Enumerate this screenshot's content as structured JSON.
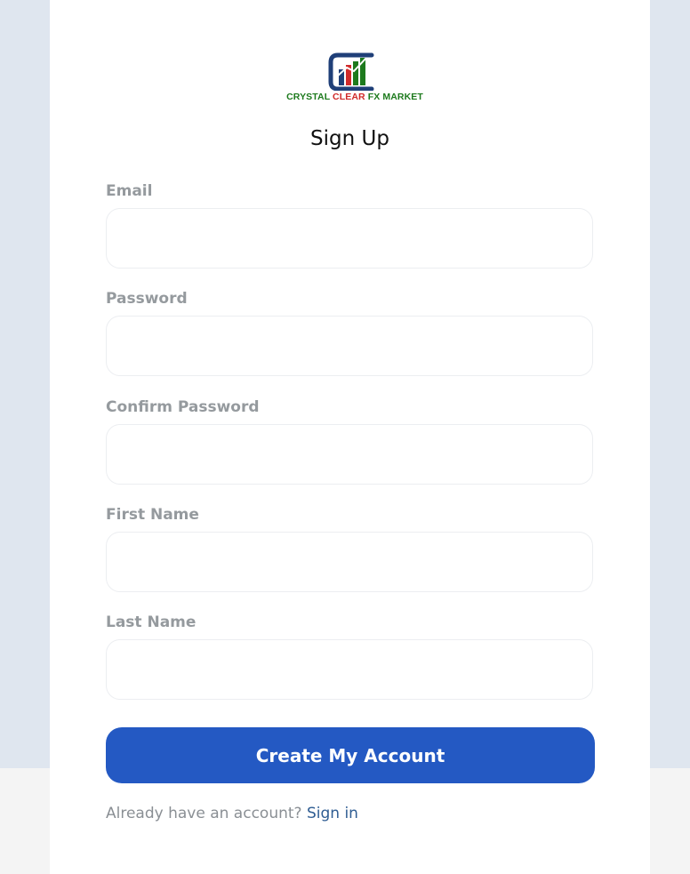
{
  "brand": {
    "name_part1": "CRYSTAL ",
    "name_part2": "CLEAR",
    "name_part3": " FX MARKET",
    "colors": {
      "green": "#1d7a1d",
      "red": "#d12a2a",
      "navy": "#1f3f78"
    }
  },
  "form": {
    "title": "Sign Up",
    "fields": [
      {
        "label": "Email",
        "value": "",
        "placeholder": ""
      },
      {
        "label": "Password",
        "value": "",
        "placeholder": ""
      },
      {
        "label": "Confirm Password",
        "value": "",
        "placeholder": ""
      },
      {
        "label": "First Name",
        "value": "",
        "placeholder": ""
      },
      {
        "label": "Last Name",
        "value": "",
        "placeholder": ""
      }
    ],
    "submit_label": "Create My Account",
    "accent_color": "#2459c3"
  },
  "footer": {
    "prompt": "Already have an account? ",
    "link_label": "Sign in"
  }
}
